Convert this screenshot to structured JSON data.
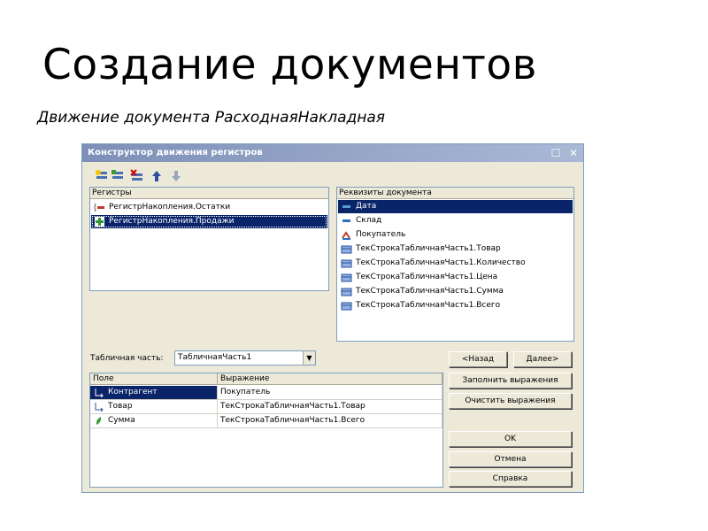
{
  "slide": {
    "title": "Создание документов",
    "subtitle": "Движение документа РасходнаяНакладная"
  },
  "window": {
    "title": "Конструктор движения регистров",
    "title_color": "#7d8fb7"
  },
  "toolbar": {
    "icons": [
      "add-register-icon",
      "add-copy-icon",
      "delete-register-icon",
      "move-up-icon",
      "move-down-icon"
    ]
  },
  "registers": {
    "header": "Регистры",
    "items": [
      {
        "label": "РегистрНакопления.Остатки",
        "icon": "register-minus-icon"
      },
      {
        "label": "РегистрНакопления.Продажи",
        "icon": "register-plus-icon",
        "selected": true
      }
    ]
  },
  "requisites": {
    "header": "Реквизиты документа",
    "items": [
      {
        "label": "Дата",
        "icon": "attribute-icon",
        "selected": true
      },
      {
        "label": "Склад",
        "icon": "attribute-icon"
      },
      {
        "label": "Покупатель",
        "icon": "user-icon"
      },
      {
        "label": "ТекСтрокаТабличнаяЧасть1.Товар",
        "icon": "table-attribute-icon"
      },
      {
        "label": "ТекСтрокаТабличнаяЧасть1.Количество",
        "icon": "table-attribute-icon"
      },
      {
        "label": "ТекСтрокаТабличнаяЧасть1.Цена",
        "icon": "table-attribute-icon"
      },
      {
        "label": "ТекСтрокаТабличнаяЧасть1.Сумма",
        "icon": "table-attribute-icon"
      },
      {
        "label": "ТекСтрокаТабличнаяЧасть1.Всего",
        "icon": "table-attribute-icon"
      }
    ]
  },
  "tabular": {
    "label": "Табличная часть:",
    "value": "ТабличнаяЧасть1"
  },
  "buttons": {
    "back": "<Назад",
    "next": "Далее>",
    "fill": "Заполнить выражения",
    "clear": "Очистить выражения",
    "ok": "OK",
    "cancel": "Отмена",
    "help": "Справка"
  },
  "grid": {
    "columns": [
      "Поле",
      "Выражение"
    ],
    "rows": [
      {
        "field": "Контрагент",
        "expr": "Покупатель",
        "icon": "dimension-icon",
        "selected": true
      },
      {
        "field": "Товар",
        "expr": "ТекСтрокаТабличнаяЧасть1.Товар",
        "icon": "dimension-icon"
      },
      {
        "field": "Сумма",
        "expr": "ТекСтрокаТабличнаяЧасть1.Всего",
        "icon": "resource-icon"
      }
    ]
  }
}
